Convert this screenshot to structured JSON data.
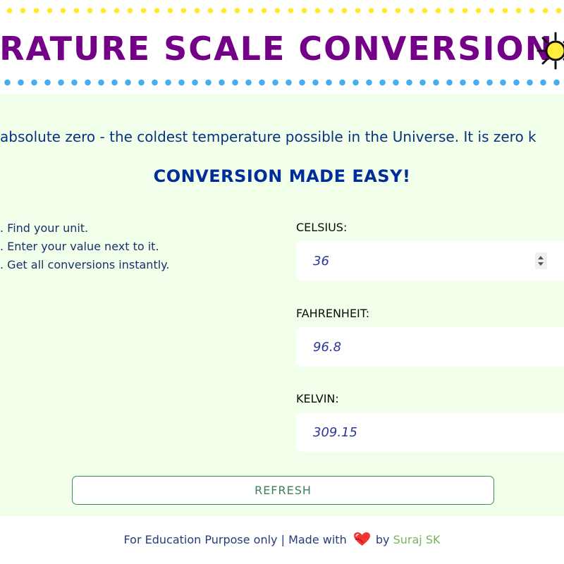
{
  "header": {
    "title": "PERATURE SCALE CONVERSION",
    "icon": "sun-icon"
  },
  "intro": {
    "text": "absolute zero - the coldest temperature possible in the Universe. It is zero k"
  },
  "main": {
    "title": "CONVERSION MADE EASY!",
    "steps": [
      ". Find your unit.",
      ". Enter your value next to it.",
      ". Get all conversions instantly."
    ],
    "fields": {
      "celsius": {
        "label": "CELSIUS:",
        "value": "36"
      },
      "fahrenheit": {
        "label": "FAHRENHEIT:",
        "value": "96.8"
      },
      "kelvin": {
        "label": "KELVIN:",
        "value": "309.15"
      }
    },
    "refresh_label": "REFRESH"
  },
  "footer": {
    "prefix": "For Education Purpose only | Made with",
    "middle": "by",
    "author": "Suraj SK",
    "heart_icon": "heart-icon"
  },
  "colors": {
    "title": "#740087",
    "top_dots": "#ffeb2a",
    "bottom_dots": "#45aef2",
    "content_background": "#f2ffea",
    "heading": "#002d9a",
    "button_border": "#3b8d5d",
    "author": "#79b35a"
  }
}
